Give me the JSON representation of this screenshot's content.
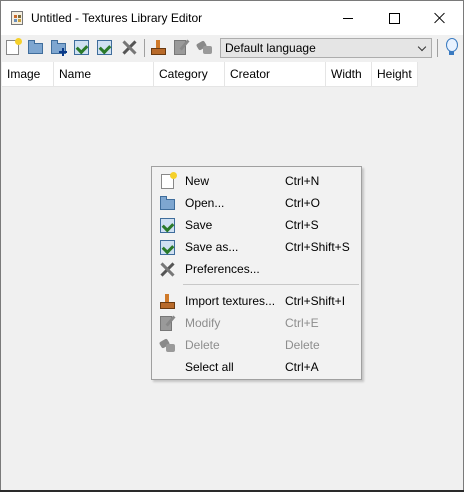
{
  "window": {
    "title": "Untitled - Textures Library Editor"
  },
  "toolbar": {
    "icons": [
      "new-file-icon",
      "open-folder-icon",
      "add-folder-icon",
      "save-icon",
      "save-as-icon",
      "preferences-icon",
      "import-icon",
      "modify-icon",
      "delete-icon"
    ],
    "language_value": "Default language",
    "help_icon": "lightbulb-icon"
  },
  "table": {
    "columns": [
      "Image",
      "Name",
      "Category",
      "Creator",
      "Width",
      "Height"
    ]
  },
  "context_menu": {
    "items": [
      {
        "label": "New",
        "shortcut": "Ctrl+N",
        "icon": "new-file-icon",
        "enabled": true
      },
      {
        "label": "Open...",
        "shortcut": "Ctrl+O",
        "icon": "open-folder-icon",
        "enabled": true
      },
      {
        "label": "Save",
        "shortcut": "Ctrl+S",
        "icon": "save-icon",
        "enabled": true
      },
      {
        "label": "Save as...",
        "shortcut": "Ctrl+Shift+S",
        "icon": "save-as-icon",
        "enabled": true
      },
      {
        "label": "Preferences...",
        "shortcut": "",
        "icon": "preferences-icon",
        "enabled": true
      },
      {
        "label": "Import textures...",
        "shortcut": "Ctrl+Shift+I",
        "icon": "import-icon",
        "enabled": true
      },
      {
        "label": "Modify",
        "shortcut": "Ctrl+E",
        "icon": "modify-icon",
        "enabled": false
      },
      {
        "label": "Delete",
        "shortcut": "Delete",
        "icon": "delete-icon",
        "enabled": false
      },
      {
        "label": "Select all",
        "shortcut": "Ctrl+A",
        "icon": "",
        "enabled": true
      }
    ]
  }
}
